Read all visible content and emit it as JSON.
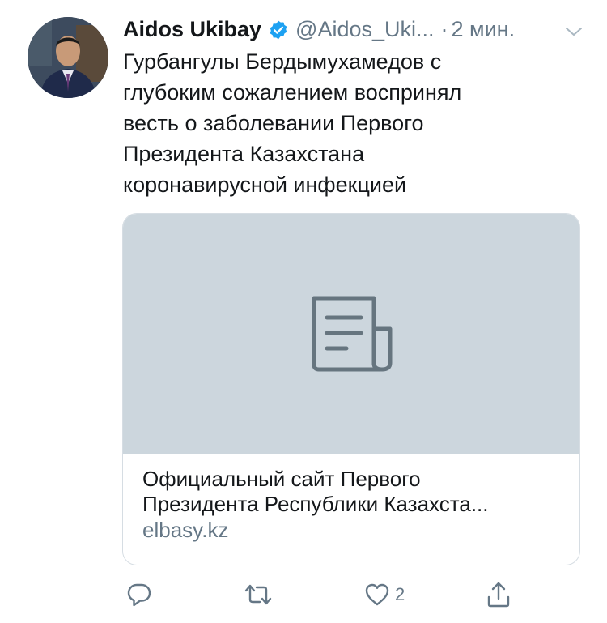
{
  "tweet": {
    "display_name": "Aidos Ukibay",
    "handle": "@Aidos_Uki...",
    "separator": "·",
    "time": "2 мин.",
    "text_lines": [
      "Гурбангулы Бердымухамедов с",
      "глубоким сожалением воспринял",
      "весть о заболевании Первого",
      "Президента Казахстана",
      "коронавирусной инфекцией"
    ]
  },
  "card": {
    "title_line1": "Официальный сайт Первого",
    "title_line2": "Президента Республики Казахста...",
    "domain": "elbasy.kz"
  },
  "actions": {
    "reply_count": "",
    "retweet_count": "",
    "like_count": "2"
  },
  "icons": {
    "verified": "verified-badge-icon",
    "caret": "chevron-down-icon",
    "card_placeholder": "document-icon",
    "reply": "reply-icon",
    "retweet": "retweet-icon",
    "like": "heart-icon",
    "share": "share-icon"
  },
  "colors": {
    "verified_blue": "#1da1f2",
    "secondary_text": "#657786",
    "card_media_bg": "#ccd6dd",
    "card_border": "#d6dde3",
    "primary_text": "#14171a"
  }
}
